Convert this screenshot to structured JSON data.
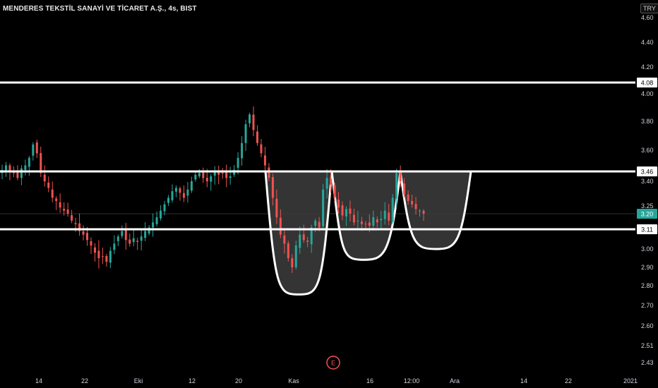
{
  "header": {
    "title": "MENDERES TEKSTİL SANAYİ VE TİCARET A.Ş., 4s, BIST",
    "currency": "TRY"
  },
  "colors": {
    "background": "#000000",
    "up": "#26a69a",
    "down": "#ef5350",
    "levels": "#ffffff",
    "pattern_fill": "#3a3a3a",
    "price_badge": "#26a69a",
    "event_marker": "#ef5350"
  },
  "event_marker": {
    "label": "E"
  },
  "chart_data": {
    "type": "candlestick",
    "ylim": [
      2.43,
      4.62
    ],
    "y_ticks": [
      "4.60",
      "4.40",
      "4.20",
      "4.00",
      "3.80",
      "3.60",
      "3.40",
      "3.25",
      "3.00",
      "2.90",
      "2.80",
      "2.70",
      "2.60",
      "2.51",
      "2.43"
    ],
    "x_ticks": [
      "14",
      "22",
      "Eki",
      "12",
      "20",
      "Kas",
      "16",
      "12:00",
      "Ara",
      "14",
      "22",
      "2021"
    ],
    "price_levels": [
      {
        "label": "4.08",
        "value": 4.08
      },
      {
        "label": "3.46",
        "value": 3.46
      },
      {
        "label": "3.11",
        "value": 3.11
      }
    ],
    "current_price": {
      "label": "3.20",
      "value": 3.2
    },
    "pattern": {
      "name": "",
      "neckline": 3.46,
      "lows": [
        2.86,
        3.05,
        3.11
      ]
    },
    "close_series": [
      3.47,
      3.5,
      3.46,
      3.45,
      3.42,
      3.48,
      3.5,
      3.55,
      3.64,
      3.58,
      3.45,
      3.4,
      3.36,
      3.3,
      3.28,
      3.24,
      3.22,
      3.2,
      3.16,
      3.14,
      3.1,
      3.08,
      3.05,
      3.02,
      2.98,
      2.95,
      2.96,
      2.93,
      2.99,
      3.03,
      3.07,
      3.1,
      3.05,
      3.03,
      3.06,
      3.04,
      3.07,
      3.1,
      3.12,
      3.15,
      3.18,
      3.22,
      3.26,
      3.3,
      3.34,
      3.36,
      3.33,
      3.3,
      3.35,
      3.4,
      3.44,
      3.45,
      3.42,
      3.4,
      3.43,
      3.46,
      3.44,
      3.45,
      3.42,
      3.43,
      3.47,
      3.55,
      3.65,
      3.78,
      3.85,
      3.74,
      3.65,
      3.58,
      3.5,
      3.42,
      3.3,
      3.18,
      3.08,
      3.03,
      2.95,
      2.9,
      3.02,
      3.08,
      3.05,
      3.04,
      3.12,
      3.16,
      3.12,
      3.35,
      3.42,
      3.38,
      3.3,
      3.24,
      3.19,
      3.23,
      3.2,
      3.15,
      3.16,
      3.14,
      3.14,
      3.13,
      3.18,
      3.15,
      3.17,
      3.22,
      3.16,
      3.3,
      3.45,
      3.4,
      3.32,
      3.28,
      3.26,
      3.23,
      3.22,
      3.2
    ]
  }
}
